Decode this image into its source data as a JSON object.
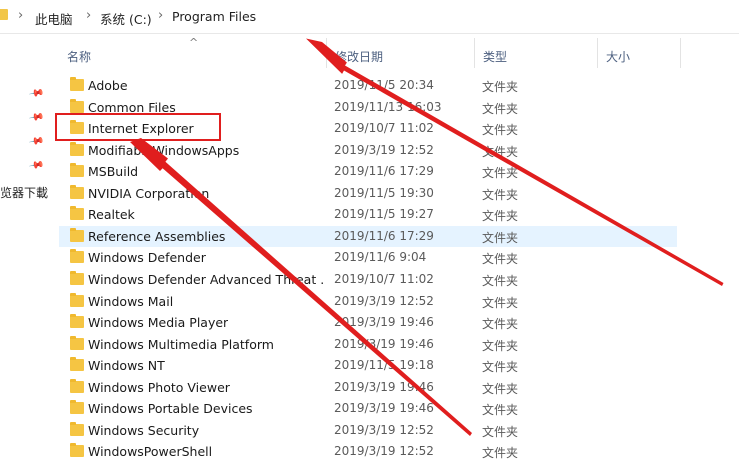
{
  "breadcrumb": {
    "items": [
      "此电脑",
      "系统 (C:)",
      "Program Files"
    ],
    "separator": "›"
  },
  "nav": {
    "quick_access_partial": "览器下載"
  },
  "columns": {
    "name": "名称",
    "date_modified": "修改日期",
    "type": "类型",
    "size": "大小"
  },
  "files": [
    {
      "name": "Adobe",
      "date": "2019/11/5 20:34",
      "type": "文件夹"
    },
    {
      "name": "Common Files",
      "date": "2019/11/13 16:03",
      "type": "文件夹"
    },
    {
      "name": "Internet Explorer",
      "date": "2019/10/7 11:02",
      "type": "文件夹"
    },
    {
      "name": "ModifiableWindowsApps",
      "date": "2019/3/19 12:52",
      "type": "文件夹"
    },
    {
      "name": "MSBuild",
      "date": "2019/11/6 17:29",
      "type": "文件夹"
    },
    {
      "name": "NVIDIA Corporation",
      "date": "2019/11/5 19:30",
      "type": "文件夹"
    },
    {
      "name": "Realtek",
      "date": "2019/11/5 19:27",
      "type": "文件夹"
    },
    {
      "name": "Reference Assemblies",
      "date": "2019/11/6 17:29",
      "type": "文件夹"
    },
    {
      "name": "Windows Defender",
      "date": "2019/11/6 9:04",
      "type": "文件夹"
    },
    {
      "name": "Windows Defender Advanced Threat ...",
      "date": "2019/10/7 11:02",
      "type": "文件夹"
    },
    {
      "name": "Windows Mail",
      "date": "2019/3/19 12:52",
      "type": "文件夹"
    },
    {
      "name": "Windows Media Player",
      "date": "2019/3/19 19:46",
      "type": "文件夹"
    },
    {
      "name": "Windows Multimedia Platform",
      "date": "2019/3/19 19:46",
      "type": "文件夹"
    },
    {
      "name": "Windows NT",
      "date": "2019/11/5 19:18",
      "type": "文件夹"
    },
    {
      "name": "Windows Photo Viewer",
      "date": "2019/3/19 19:46",
      "type": "文件夹"
    },
    {
      "name": "Windows Portable Devices",
      "date": "2019/3/19 19:46",
      "type": "文件夹"
    },
    {
      "name": "Windows Security",
      "date": "2019/3/19 12:52",
      "type": "文件夹"
    },
    {
      "name": "WindowsPowerShell",
      "date": "2019/3/19 12:52",
      "type": "文件夹"
    }
  ],
  "selected_file": "Reference Assemblies",
  "highlighted_file": "Internet Explorer",
  "colors": {
    "annotation": "#e01e1e",
    "selection": "#e5f3ff",
    "folder": "#f5c543",
    "header_text": "#4d6080"
  }
}
